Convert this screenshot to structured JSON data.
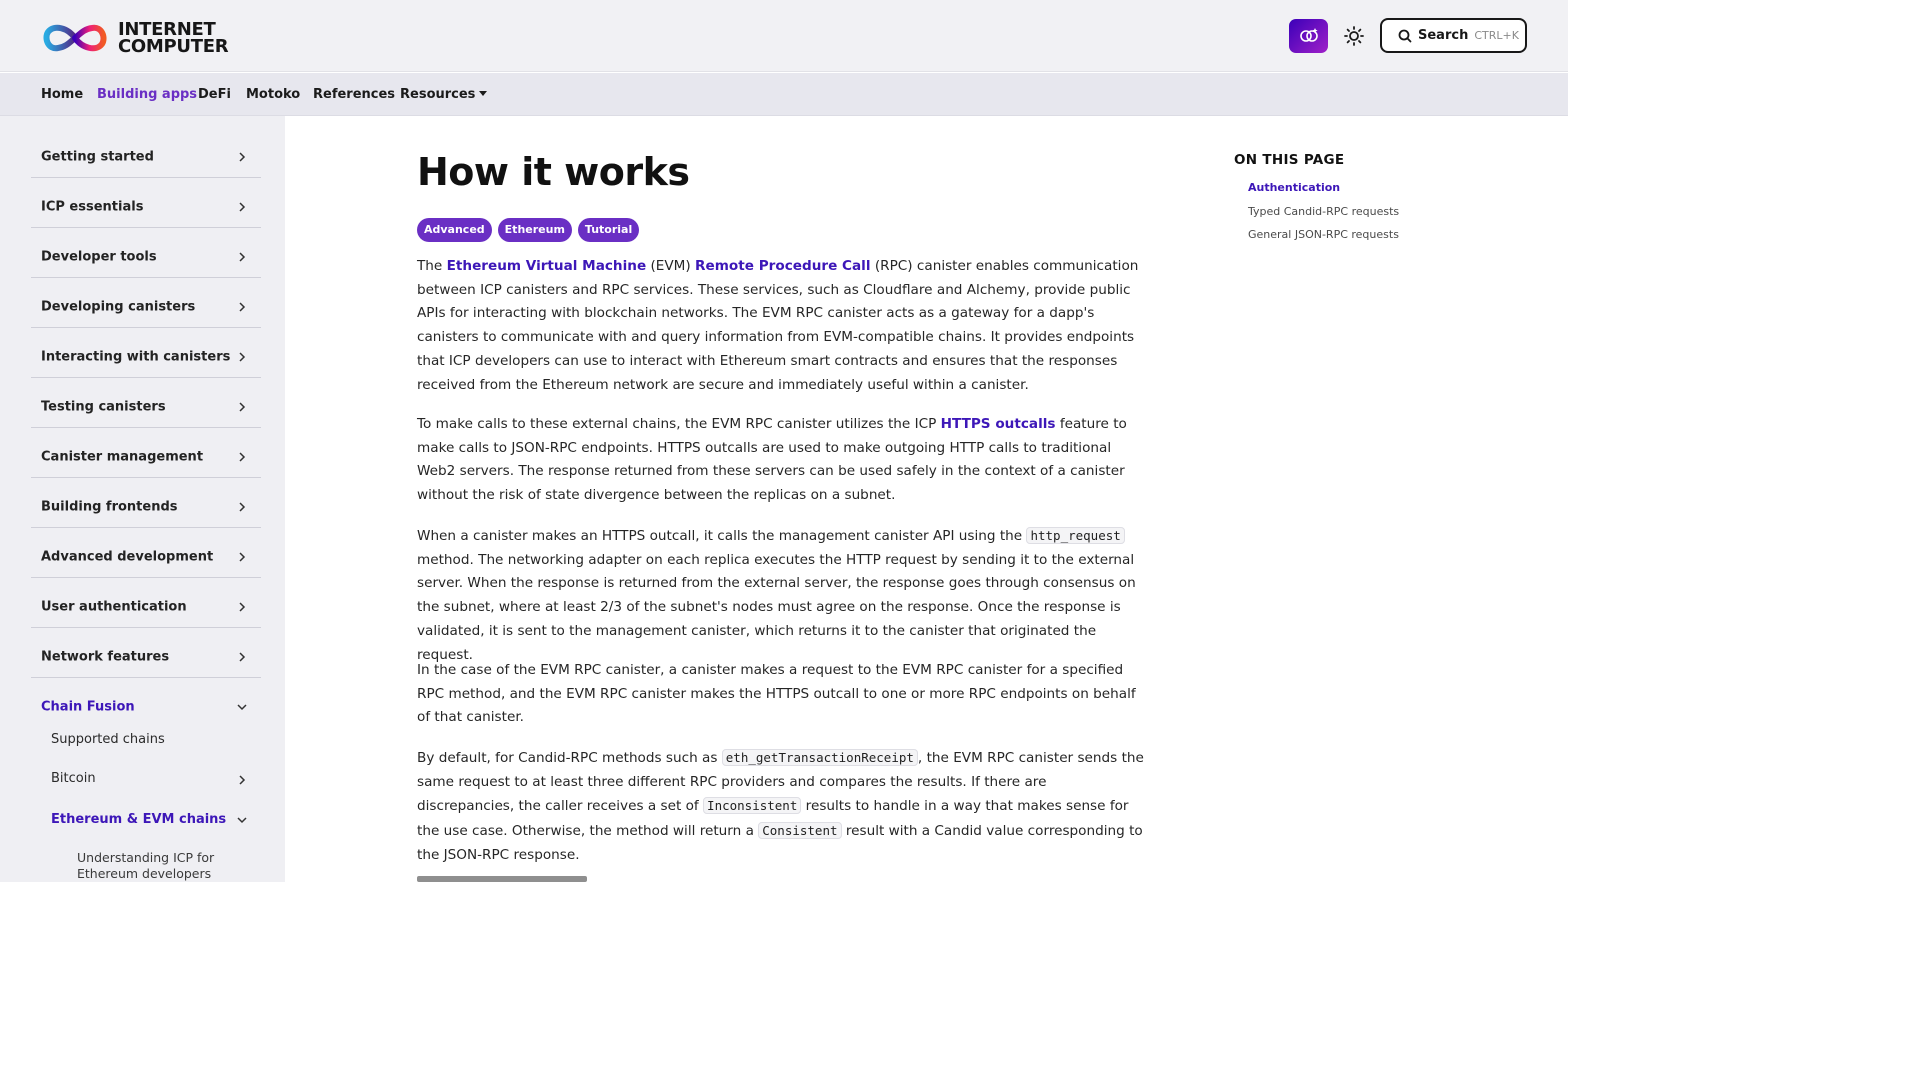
{
  "header": {
    "logo_line1": "INTERNET",
    "logo_line2": "COMPUTER",
    "search_label": "Search",
    "search_shortcut": "CTRL+K",
    "accent_color": "#6a2fc4"
  },
  "nav": {
    "items": [
      {
        "label": "Home",
        "active": false
      },
      {
        "label": "Building apps",
        "active": true
      },
      {
        "label": "DeFi",
        "active": false
      },
      {
        "label": "Motoko",
        "active": false
      },
      {
        "label": "References",
        "active": false
      },
      {
        "label": "Resources",
        "active": false,
        "dropdown": true
      }
    ]
  },
  "sidebar": {
    "items": [
      {
        "label": "Getting started"
      },
      {
        "label": "ICP essentials"
      },
      {
        "label": "Developer tools"
      },
      {
        "label": "Developing canisters"
      },
      {
        "label": "Interacting with canisters"
      },
      {
        "label": "Testing canisters"
      },
      {
        "label": "Canister management"
      },
      {
        "label": "Building frontends"
      },
      {
        "label": "Advanced development"
      },
      {
        "label": "User authentication"
      },
      {
        "label": "Network features"
      },
      {
        "label": "Chain Fusion",
        "active": true,
        "expanded": true
      }
    ],
    "sub_items": [
      {
        "label": "Supported chains"
      },
      {
        "label": "Bitcoin"
      },
      {
        "label": "Ethereum & EVM chains",
        "active": true,
        "expanded": true
      }
    ],
    "subsub_item": "Understanding ICP for Ethereum developers"
  },
  "main": {
    "title": "How it works",
    "tags": [
      "Advanced",
      "Ethereum",
      "Tutorial"
    ],
    "p1": {
      "t1": "The ",
      "link1": "Ethereum Virtual Machine",
      "t2": " (EVM) ",
      "link2": "Remote Procedure Call",
      "t3": " (RPC) canister enables communication between ICP canisters and RPC services. These services, such as Cloudflare and Alchemy, provide public APIs for interacting with blockchain networks. The EVM RPC canister acts as a gateway for a dapp's canisters to communicate with and query information from EVM-compatible chains. It provides endpoints that ICP developers can use to interact with Ethereum smart contracts and ensures that the responses received from the Ethereum network are secure and immediately useful within a canister."
    },
    "p2": {
      "t1": "To make calls to these external chains, the EVM RPC canister utilizes the ICP ",
      "link1": "HTTPS outcalls",
      "t2": " feature to make calls to JSON-RPC endpoints. HTTPS outcalls are used to make outgoing HTTP calls to traditional Web2 servers. The response returned from these servers can be used safely in the context of a canister without the risk of state divergence between the replicas on a subnet."
    },
    "p3": {
      "t1": "When a canister makes an HTTPS outcall, it calls the management canister API using the ",
      "code1": "http_request",
      "t2": " method. The networking adapter on each replica executes the HTTP request by sending it to the external server. When the response is returned from the external server, the response goes through consensus on the subnet, where at least 2/3 of the subnet's nodes must agree on the response. Once the response is validated, it is sent to the management canister, which returns it to the canister that originated the request."
    },
    "p4": "In the case of the EVM RPC canister, a canister makes a request to the EVM RPC canister for a specified RPC method, and the EVM RPC canister makes the HTTPS outcall to one or more RPC endpoints on behalf of that canister.",
    "p5": {
      "t1": "By default, for Candid-RPC methods such as ",
      "code1": "eth_getTransactionReceipt",
      "t2": ", the EVM RPC canister sends the same request to at least three different RPC providers and compares the results. If there are discrepancies, the caller receives a set of ",
      "code2": "Inconsistent",
      "t3": " results to handle in a way that makes sense for the use case. Otherwise, the method will return a ",
      "code3": "Consistent",
      "t4": " result with a Candid value corresponding to the JSON-RPC response."
    }
  },
  "toc": {
    "title": "ON THIS PAGE",
    "items": [
      {
        "label": "Authentication",
        "active": true
      },
      {
        "label": "Typed Candid-RPC requests",
        "active": false
      },
      {
        "label": "General JSON-RPC requests",
        "active": false
      }
    ]
  }
}
